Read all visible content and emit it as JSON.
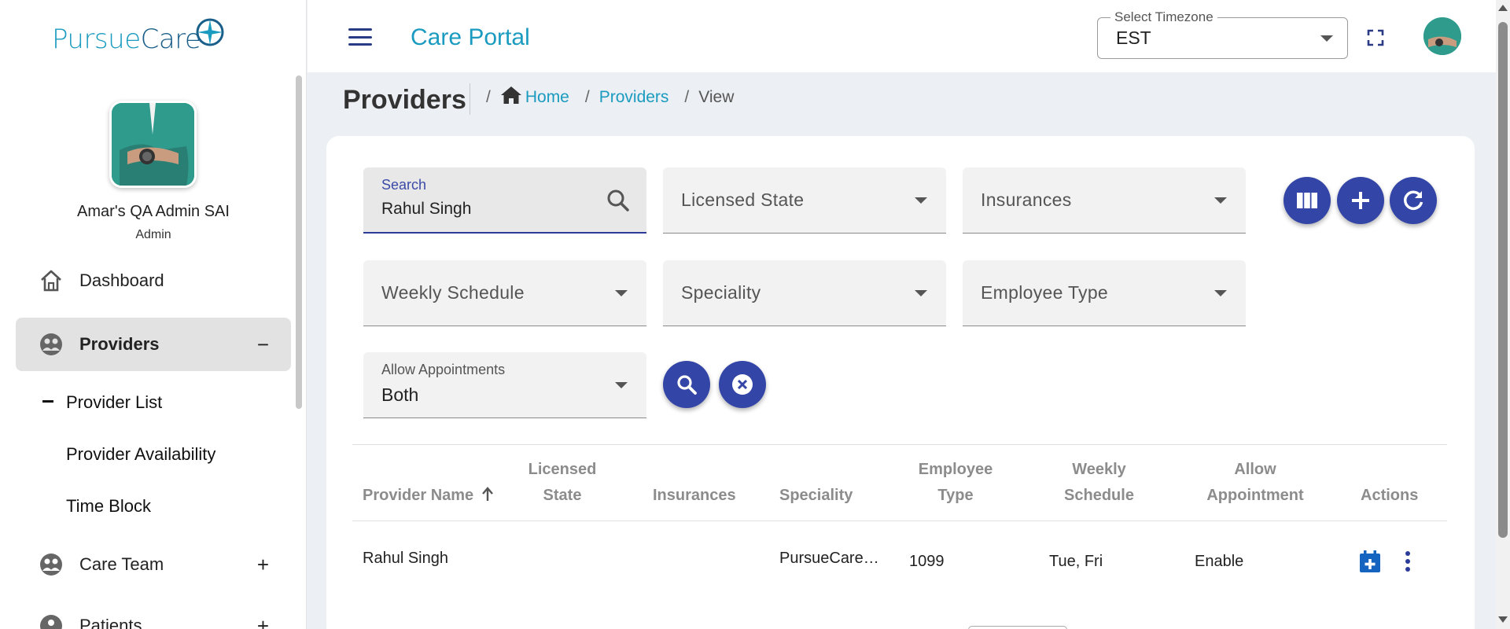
{
  "app": {
    "logo_text_1": "Pursue",
    "logo_text_2": "Care",
    "portal_title": "Care Portal"
  },
  "user": {
    "name": "Amar's QA Admin SAI",
    "role": "Admin"
  },
  "sidebar": {
    "items": [
      {
        "label": "Dashboard",
        "icon": "home-icon",
        "toggle": ""
      },
      {
        "label": "Providers",
        "icon": "providers-icon",
        "toggle": "−",
        "active": true
      },
      {
        "label": "Care Team",
        "icon": "care-team-icon",
        "toggle": "+"
      },
      {
        "label": "Patients",
        "icon": "patients-icon",
        "toggle": "+"
      }
    ],
    "sub_items": [
      {
        "label": "Provider List",
        "selected": true
      },
      {
        "label": "Provider Availability"
      },
      {
        "label": "Time Block"
      }
    ]
  },
  "header": {
    "timezone_label": "Select Timezone",
    "timezone_value": "EST"
  },
  "breadcrumb": {
    "page_title": "Providers",
    "home": "Home",
    "providers": "Providers",
    "current": "View"
  },
  "filters": {
    "search_label": "Search",
    "search_value": "Rahul Singh",
    "licensed_state": "Licensed State",
    "insurances": "Insurances",
    "weekly_schedule": "Weekly Schedule",
    "speciality": "Speciality",
    "employee_type": "Employee Type",
    "allow_appointments_label": "Allow Appointments",
    "allow_appointments_value": "Both"
  },
  "table": {
    "headers": {
      "provider_name": "Provider Name",
      "licensed_state_1": "Licensed",
      "licensed_state_2": "State",
      "insurances": "Insurances",
      "speciality": "Speciality",
      "employee_type_1": "Employee",
      "employee_type_2": "Type",
      "weekly_schedule_1": "Weekly",
      "weekly_schedule_2": "Schedule",
      "allow_appointment_1": "Allow",
      "allow_appointment_2": "Appointment",
      "actions": "Actions"
    },
    "rows": [
      {
        "provider_name": "Rahul Singh",
        "licensed_state": "",
        "insurances": "",
        "speciality": "PursueCare…",
        "employee_type": "1099",
        "weekly_schedule": "Tue, Fri",
        "allow_appointment": "Enable"
      }
    ]
  },
  "colors": {
    "brand_teal": "#1a9bbf",
    "brand_navy": "#1a5f8a",
    "fab_blue": "#3345a6",
    "action_blue": "#1565c0"
  }
}
